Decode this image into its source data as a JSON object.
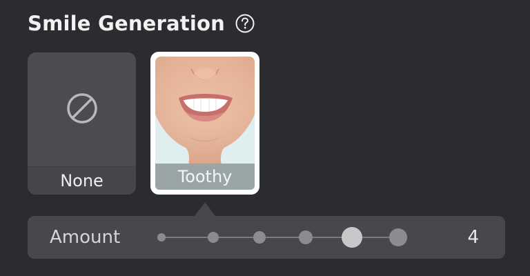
{
  "section": {
    "title": "Smile Generation",
    "help_icon": "question-circle-icon"
  },
  "options": [
    {
      "label": "None",
      "icon": "prohibited-icon",
      "selected": false
    },
    {
      "label": "Toothy",
      "image": "smiling-mouth-photo",
      "selected": true
    }
  ],
  "amount": {
    "label": "Amount",
    "value": "4",
    "steps": 6,
    "selected_index": 4
  },
  "colors": {
    "background": "#2a2c2f",
    "tile": "#4a4c50",
    "selected_border": "#ffffff",
    "selected_label_bg": "#9aa5a6"
  }
}
